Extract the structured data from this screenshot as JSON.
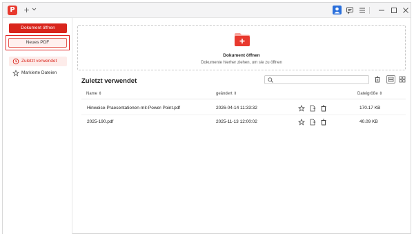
{
  "titlebar": {
    "logo_letter": "P",
    "new_tab_symbol": "+",
    "icons": [
      "profile-icon",
      "chat-icon",
      "menu-icon",
      "minimize-icon",
      "maximize-icon",
      "close-icon"
    ]
  },
  "sidebar": {
    "open_button": "Dokument öffnen",
    "new_pdf_button": "Neues PDF",
    "items": [
      {
        "label": "Zuletzt verwendet",
        "icon": "clock-icon",
        "active": true
      },
      {
        "label": "Markierte Dateien",
        "icon": "star-icon",
        "active": false
      }
    ]
  },
  "dropzone": {
    "title": "Dokument öffnen",
    "hint": "Dokumente hierher ziehen, um sie zu öffnen"
  },
  "recent": {
    "title": "Zuletzt verwendet",
    "search_placeholder": "",
    "columns": {
      "name": "Name ⇕",
      "modified": "geändert ⇕",
      "size": "Dateigröße ⇕"
    },
    "files": [
      {
        "name": "Hinweise-Praesentationen-mit-Power-Point.pdf",
        "modified": "2026-04-14 11:33:32",
        "size": "170.17 KB"
      },
      {
        "name": "2025-190.pdf",
        "modified": "2025-11-13 12:00:02",
        "size": "40.09 KB"
      }
    ]
  },
  "colors": {
    "accent": "#d9251c",
    "accent_light": "#fdecea",
    "highlight_border": "#e02020"
  }
}
